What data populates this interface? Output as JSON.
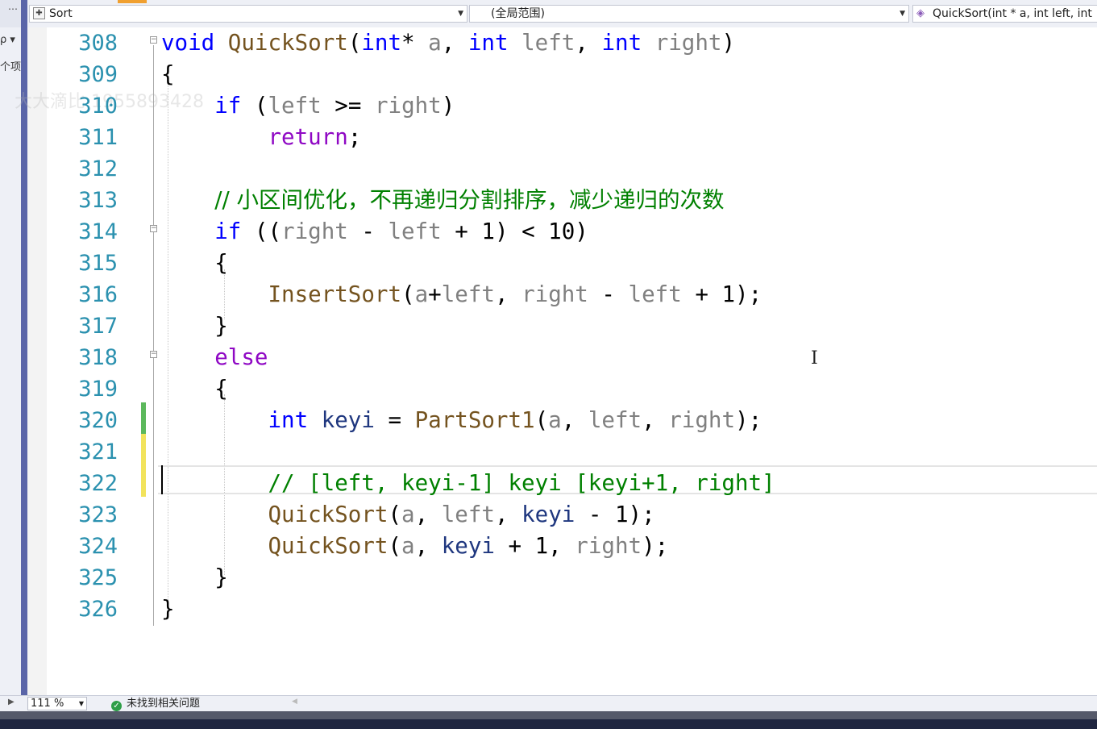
{
  "nav": {
    "project": "Sort",
    "scope": "(全局范围)",
    "member": "QuickSort(int * a, int left, int"
  },
  "left_panel": {
    "a": "ρ ▾",
    "b": "个项"
  },
  "watermark": "大大滴比 1955893428",
  "editor": {
    "lines": [
      {
        "num": "308"
      },
      {
        "num": "309"
      },
      {
        "num": "310"
      },
      {
        "num": "311"
      },
      {
        "num": "312"
      },
      {
        "num": "313"
      },
      {
        "num": "314"
      },
      {
        "num": "315"
      },
      {
        "num": "316"
      },
      {
        "num": "317"
      },
      {
        "num": "318"
      },
      {
        "num": "319"
      },
      {
        "num": "320"
      },
      {
        "num": "321"
      },
      {
        "num": "322"
      },
      {
        "num": "323"
      },
      {
        "num": "324"
      },
      {
        "num": "325"
      },
      {
        "num": "326"
      }
    ],
    "tokens": {
      "void": "void",
      "QuickSort": "QuickSort",
      "int": "int",
      "a": "a",
      "left": "left",
      "right": "right",
      "if": "if",
      "return": "return",
      "else": "else",
      "InsertSort": "InsertSort",
      "PartSort1": "PartSort1",
      "keyi": "keyi",
      "comment_313": "// 小区间优化，不再递归分割排序，减少递归的次数",
      "comment_322": "// [left, keyi-1] keyi [keyi+1, right]"
    }
  },
  "status": {
    "zoom": "111 %",
    "issues": "未找到相关问题"
  },
  "colors": {
    "keyword": "#0000ff",
    "function": "#74531f",
    "parameter": "#808080",
    "local": "#1f377f",
    "comment": "#008000",
    "line_number": "#2b91af",
    "changed_saved": "#5cb85c",
    "changed_unsaved": "#f2e35c"
  }
}
